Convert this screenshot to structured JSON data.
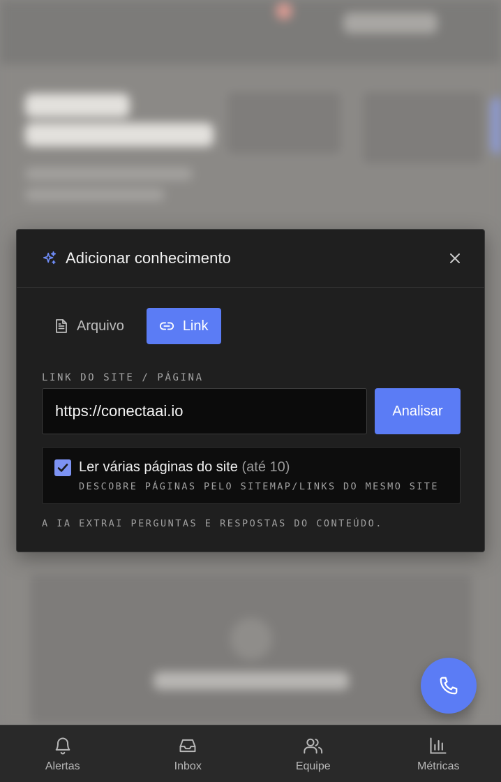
{
  "modal": {
    "title": "Adicionar conhecimento",
    "tabs": [
      {
        "label": "Arquivo",
        "icon": "file-text-icon",
        "active": false
      },
      {
        "label": "Link",
        "icon": "link-icon",
        "active": true
      }
    ],
    "field_label": "LINK DO SITE / PÁGINA",
    "url_value": "https://conectaai.io",
    "analyze_label": "Analisar",
    "multi_page": {
      "checked": true,
      "label": "Ler várias páginas do site",
      "hint": "(até 10)",
      "description": "DESCOBRE PÁGINAS PELO SITEMAP/LINKS DO MESMO SITE"
    },
    "footer_note": "A IA EXTRAI PERGUNTAS E RESPOSTAS DO CONTEÚDO."
  },
  "fab": {
    "icon": "phone-icon"
  },
  "bottom_nav": {
    "items": [
      {
        "label": "Alertas",
        "icon": "bell-icon"
      },
      {
        "label": "Inbox",
        "icon": "inbox-icon"
      },
      {
        "label": "Equipe",
        "icon": "users-icon"
      },
      {
        "label": "Métricas",
        "icon": "bar-chart-icon"
      }
    ]
  },
  "colors": {
    "accent": "#5b7cf5",
    "modal_bg": "#1f1f1f",
    "input_bg": "#0b0b0b",
    "nav_bg": "#292929"
  }
}
